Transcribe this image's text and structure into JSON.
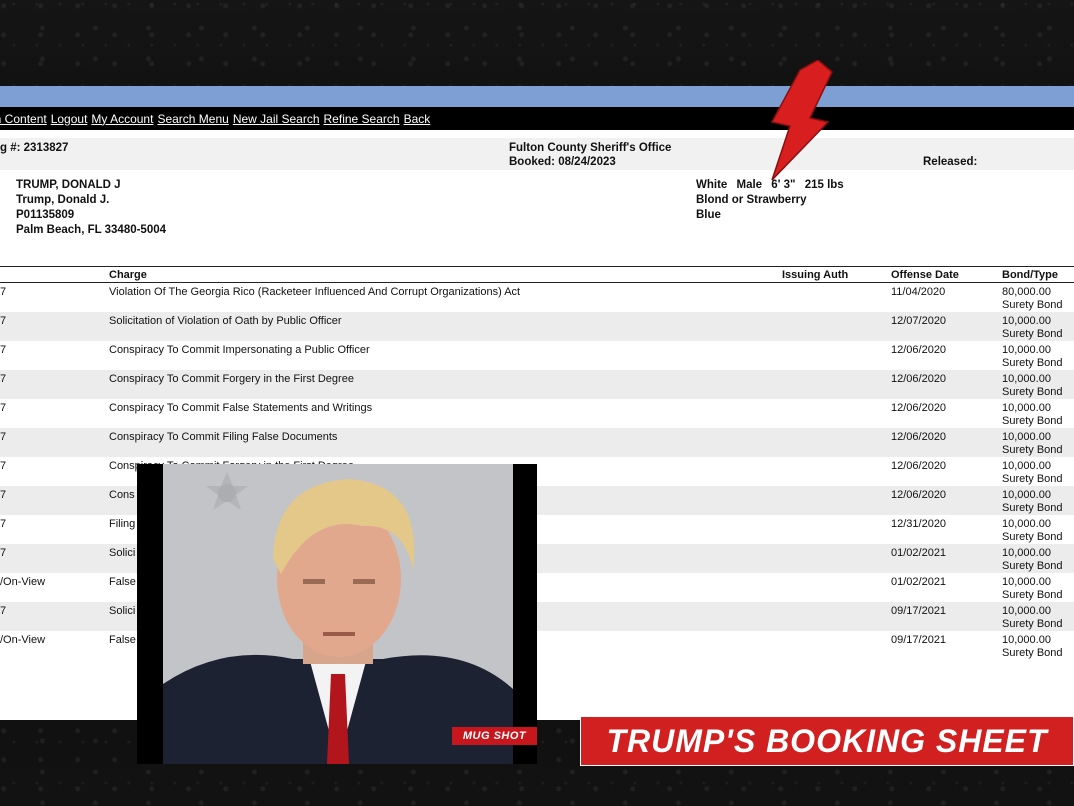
{
  "nav": {
    "links": [
      "in Content",
      "Logout",
      "My Account",
      "Search Menu",
      "New Jail Search",
      "Refine Search",
      "Back"
    ]
  },
  "header": {
    "booking": "g #: 2313827",
    "office": "Fulton County Sheriff's Office",
    "booked": "Booked: 08/24/2023",
    "released": "Released:"
  },
  "person": {
    "name_upper": "TRUMP, DONALD J",
    "name": "Trump, Donald J.",
    "id": "P01135809",
    "city": "Palm Beach, FL 33480-5004",
    "race": "White",
    "sex": "Male",
    "height": "6' 3\"",
    "weight": "215 lbs",
    "hair": "Blond or Strawberry",
    "eyes": "Blue"
  },
  "table": {
    "headers": [
      "",
      "Charge",
      "Issuing Auth",
      "Offense Date",
      "Bond/Type"
    ],
    "rows": [
      {
        "case": "7",
        "charge": "Violation Of The Georgia Rico (Racketeer Influenced And Corrupt Organizations) Act",
        "auth": "",
        "date": "11/04/2020",
        "amount": "80,000.00",
        "type": "Surety Bond"
      },
      {
        "case": "7",
        "charge": "Solicitation of Violation of Oath by Public Officer",
        "auth": "",
        "date": "12/07/2020",
        "amount": "10,000.00",
        "type": "Surety Bond"
      },
      {
        "case": "7",
        "charge": "Conspiracy To Commit Impersonating a Public Officer",
        "auth": "",
        "date": "12/06/2020",
        "amount": "10,000.00",
        "type": "Surety Bond"
      },
      {
        "case": "7",
        "charge": "Conspiracy To Commit Forgery in the First Degree",
        "auth": "",
        "date": "12/06/2020",
        "amount": "10,000.00",
        "type": "Surety Bond"
      },
      {
        "case": "7",
        "charge": "Conspiracy To Commit False Statements and Writings",
        "auth": "",
        "date": "12/06/2020",
        "amount": "10,000.00",
        "type": "Surety Bond"
      },
      {
        "case": "7",
        "charge": "Conspiracy To Commit Filing False Documents",
        "auth": "",
        "date": "12/06/2020",
        "amount": "10,000.00",
        "type": "Surety Bond"
      },
      {
        "case": "7",
        "charge": "Conspiracy To Commit Forgery in the First Degree",
        "auth": "",
        "date": "12/06/2020",
        "amount": "10,000.00",
        "type": "Surety Bond"
      },
      {
        "case": "7",
        "charge": "Cons",
        "auth": "",
        "date": "12/06/2020",
        "amount": "10,000.00",
        "type": "Surety Bond"
      },
      {
        "case": "7",
        "charge": "Filing",
        "auth": "",
        "date": "12/31/2020",
        "amount": "10,000.00",
        "type": "Surety Bond"
      },
      {
        "case": "7",
        "charge": "Solici",
        "auth": "",
        "date": "01/02/2021",
        "amount": "10,000.00",
        "type": "Surety Bond"
      },
      {
        "case": "/On-View",
        "charge": "False",
        "auth": "",
        "date": "01/02/2021",
        "amount": "10,000.00",
        "type": "Surety Bond"
      },
      {
        "case": "7",
        "charge": "Solici",
        "auth": "",
        "date": "09/17/2021",
        "amount": "10,000.00",
        "type": "Surety Bond"
      },
      {
        "case": "/On-View",
        "charge": "False",
        "auth": "",
        "date": "09/17/2021",
        "amount": "10,000.00",
        "type": "Surety Bond"
      }
    ]
  },
  "overlay": {
    "mug_tag": "MUG SHOT",
    "banner": "TRUMP'S BOOKING SHEET"
  },
  "colors": {
    "nav_blue": "#7d9fd3",
    "banner_red": "#d21f1f",
    "arrow_red": "#d81e1e"
  }
}
